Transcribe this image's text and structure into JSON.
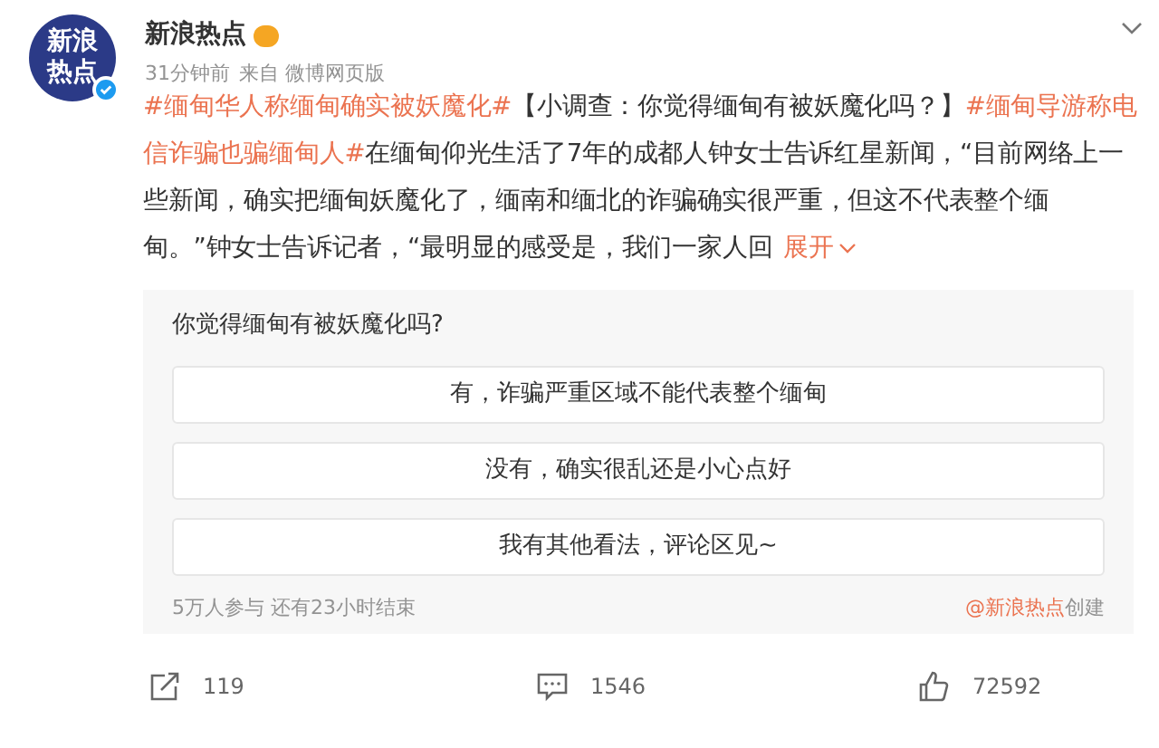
{
  "author": {
    "avatar_text": [
      "新浪",
      "热点"
    ],
    "verified": true,
    "name": "新浪热点",
    "time": "31分钟前",
    "source": "来自 微博网页版"
  },
  "post": {
    "segments": [
      {
        "kind": "hashtag",
        "text": "#缅甸华人称缅甸确实被妖魔化#"
      },
      {
        "kind": "plain",
        "text": "【小调查：你觉得缅甸有被妖魔化吗？】"
      },
      {
        "kind": "hashtag",
        "text": "#缅甸导游称电信诈骗也骗缅甸人#"
      },
      {
        "kind": "plain",
        "text": "在缅甸仰光生活了7年的成都人钟女士告诉红星新闻，“目前网络上一些新闻，确实把缅甸妖魔化了，缅南和缅北的诈骗确实很严重，但这不代表整个缅甸。”钟女士告诉记者，“最明显的感受是，我们一家人回"
      }
    ],
    "expand": "展开"
  },
  "poll": {
    "question": "你觉得缅甸有被妖魔化吗?",
    "options": [
      "有，诈骗严重区域不能代表整个缅甸",
      "没有，确实很乱还是小心点好",
      "我有其他看法，评论区见~"
    ],
    "stats": "5万人参与 还有23小时结束",
    "creator": "@新浪热点",
    "created": "创建"
  },
  "actions": [
    {
      "kind": "share",
      "count": "119"
    },
    {
      "kind": "comment",
      "count": "1546"
    },
    {
      "kind": "like",
      "count": "72592"
    }
  ]
}
